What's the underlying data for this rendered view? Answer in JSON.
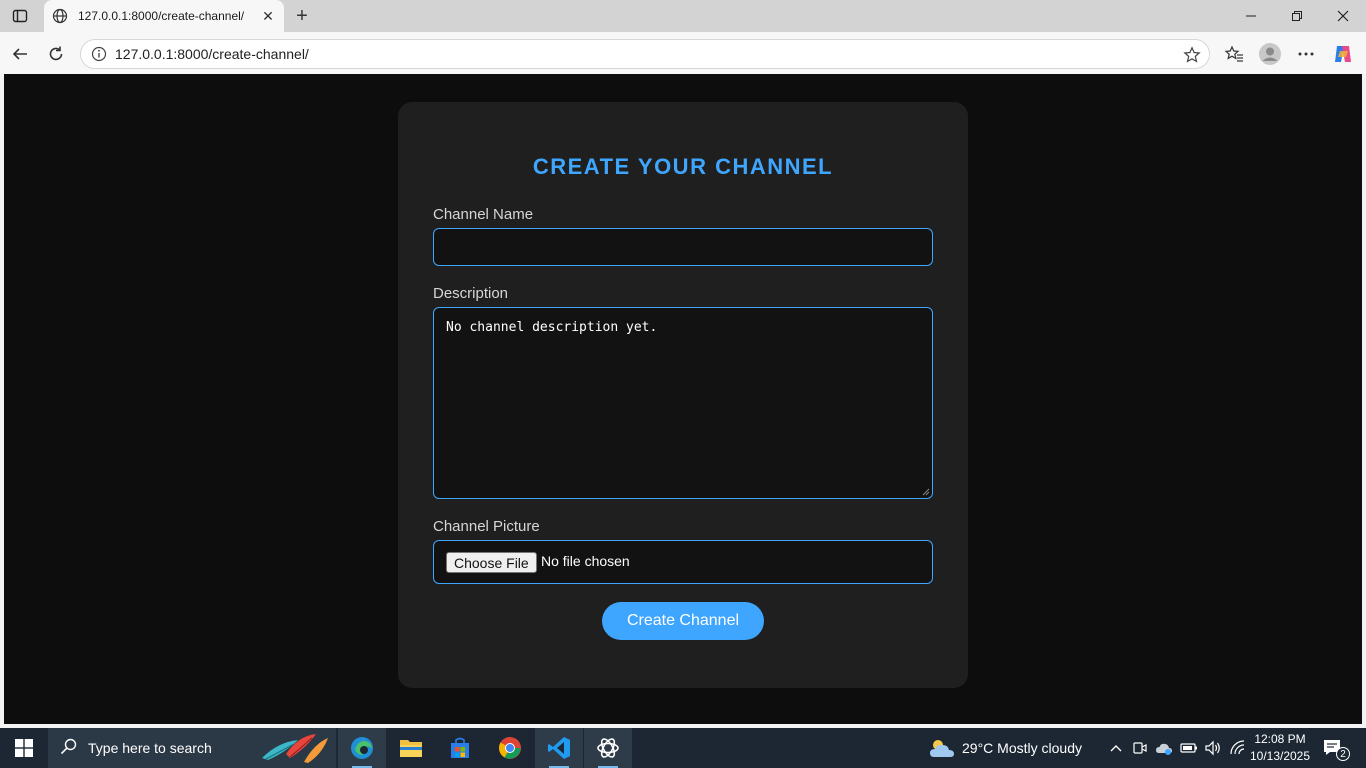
{
  "browser": {
    "tab_title": "127.0.0.1:8000/create-channel/",
    "url": "127.0.0.1:8000/create-channel/"
  },
  "form": {
    "heading": "CREATE YOUR CHANNEL",
    "channel_name_label": "Channel Name",
    "channel_name_value": "",
    "description_label": "Description",
    "description_value": "No channel description yet.",
    "picture_label": "Channel Picture",
    "choose_file_label": "Choose File",
    "no_file_text": "No file chosen",
    "submit_label": "Create Channel"
  },
  "taskbar": {
    "search_placeholder": "Type here to search",
    "weather": "29°C  Mostly cloudy",
    "time": "12:08 PM",
    "date": "10/13/2025",
    "notification_count": "2"
  },
  "colors": {
    "accent": "#3ea6ff",
    "page_bg": "#0d0d0d",
    "card_bg": "#1f1f1f"
  }
}
